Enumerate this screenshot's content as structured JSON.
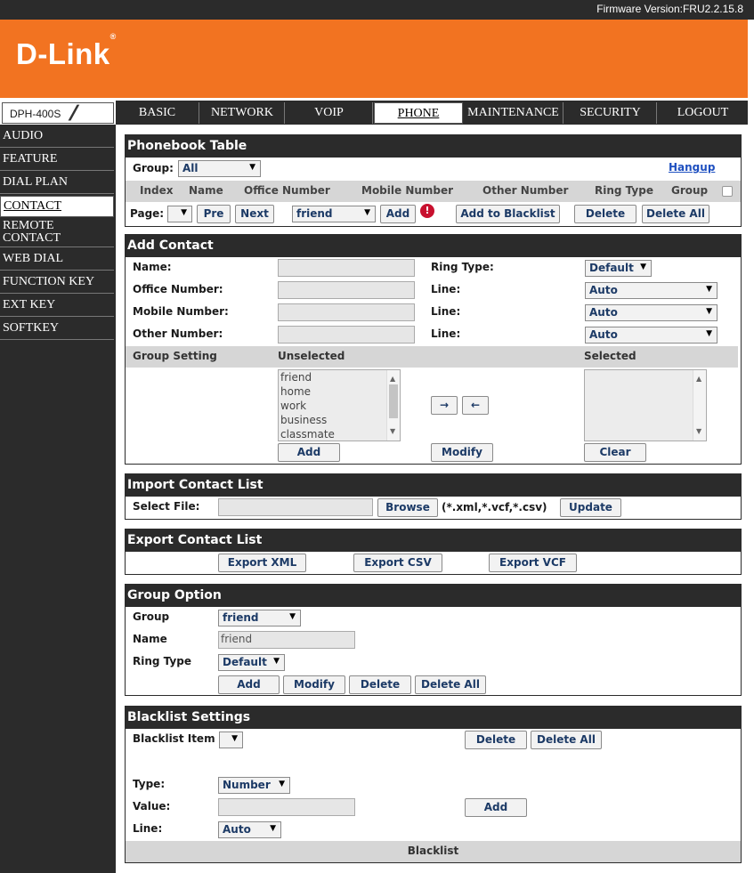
{
  "firmware": "Firmware Version:FRU2.2.15.8",
  "brand": {
    "logo_text": "D-Link",
    "logo_mark": "®",
    "model": "DPH-400S"
  },
  "nav_tabs": [
    "BASIC",
    "NETWORK",
    "VOIP",
    "PHONE",
    "MAINTENANCE",
    "SECURITY",
    "LOGOUT"
  ],
  "sidebar": [
    "AUDIO",
    "FEATURE",
    "DIAL PLAN",
    "CONTACT",
    "REMOTE CONTACT",
    "WEB DIAL",
    "FUNCTION KEY",
    "EXT KEY",
    "SOFTKEY"
  ],
  "phonebook": {
    "title": "Phonebook Table",
    "group_label": "Group:",
    "group_value": "All",
    "hangup": "Hangup",
    "columns": [
      "Index",
      "Name",
      "Office Number",
      "Mobile Number",
      "Other Number",
      "Ring Type",
      "Group"
    ],
    "page_label": "Page:",
    "pre": "Pre",
    "next": "Next",
    "group_select": "friend",
    "add": "Add",
    "add_blacklist": "Add to Blacklist",
    "delete": "Delete",
    "delete_all": "Delete All"
  },
  "add_contact": {
    "title": "Add Contact",
    "name": "Name:",
    "office": "Office Number:",
    "mobile": "Mobile Number:",
    "other": "Other Number:",
    "ring_type": "Ring Type:",
    "ring_value": "Default",
    "line": "Line:",
    "line_value": "Auto",
    "group_setting": "Group Setting",
    "unselected": "Unselected",
    "selected": "Selected",
    "groups": [
      "friend",
      "home",
      "work",
      "business",
      "classmate"
    ],
    "right_arrow": "→",
    "left_arrow": "←",
    "add": "Add",
    "modify": "Modify",
    "clear": "Clear"
  },
  "import": {
    "title": "Import Contact List",
    "select_file": "Select File:",
    "browse": "Browse",
    "formats": "(*.xml,*.vcf,*.csv)",
    "update": "Update"
  },
  "export": {
    "title": "Export Contact List",
    "xml": "Export XML",
    "csv": "Export CSV",
    "vcf": "Export VCF"
  },
  "group_option": {
    "title": "Group Option",
    "group": "Group",
    "group_value": "friend",
    "name": "Name",
    "name_value": "friend",
    "ring_type": "Ring Type",
    "ring_value": "Default",
    "add": "Add",
    "modify": "Modify",
    "delete": "Delete",
    "delete_all": "Delete All"
  },
  "blacklist": {
    "title": "Blacklist Settings",
    "item": "Blacklist Item",
    "delete": "Delete",
    "delete_all": "Delete All",
    "type": "Type:",
    "type_value": "Number",
    "value": "Value:",
    "add": "Add",
    "line": "Line:",
    "line_value": "Auto",
    "footer": "Blacklist"
  },
  "colors": {
    "brand_orange": "#f27321",
    "dark": "#2b2b2b",
    "link": "#1f50c0",
    "button_text": "#1c3a66"
  },
  "icons": {
    "help": "exclamation-circle-icon",
    "arrow": "chevron-down-icon"
  }
}
